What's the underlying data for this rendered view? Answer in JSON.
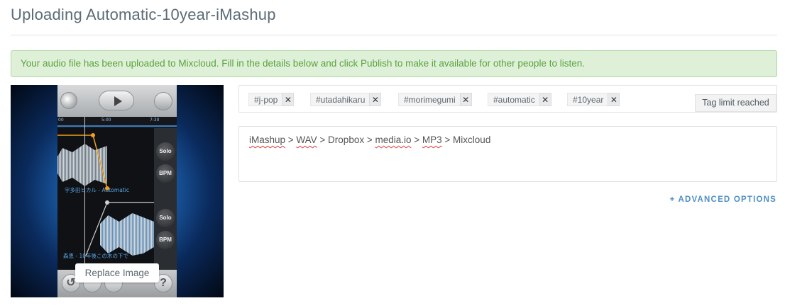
{
  "page": {
    "title": "Uploading Automatic-10year-iMashup"
  },
  "alert": {
    "message": "Your audio file has been uploaded to Mixcloud. Fill in the details below and click Publish to make it available for other people to listen."
  },
  "artwork": {
    "replace_label": "Replace Image",
    "timeline_labels": [
      "00",
      "5:00",
      "7:30"
    ],
    "track1_label": "宇多田ヒカル - Automatic",
    "track2_label": "森恵 - 10年後この木の下で",
    "side_buttons": [
      "Solo",
      "BPM",
      "Solo",
      "BPM"
    ]
  },
  "tags": {
    "items": [
      "#j-pop",
      "#utadahikaru",
      "#morimegumi",
      "#automatic",
      "#10year"
    ],
    "remove_glyph": "✕",
    "limit_label": "Tag limit reached"
  },
  "description": {
    "parts": [
      "iMashup",
      " > ",
      "WAV",
      " > Dropbox > ",
      "media.io",
      " > ",
      "MP3",
      " > Mixcloud"
    ]
  },
  "advanced": {
    "label": "+ ADVANCED OPTIONS"
  },
  "colors": {
    "alert_bg": "#dff0d8",
    "alert_text": "#5aa23f",
    "link": "#4f8fc7"
  }
}
